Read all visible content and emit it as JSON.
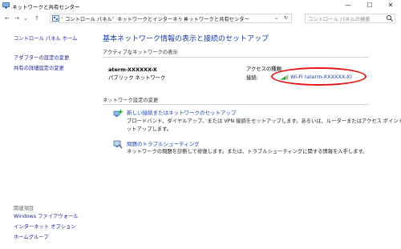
{
  "window": {
    "title": "ネットワークと共有センター"
  },
  "nav": {
    "breadcrumbs": [
      "コントロール パネル",
      "ネットワークとインターネット",
      "ネットワークと共有センター"
    ],
    "search_placeholder": "コントロール パネルの検索"
  },
  "sidebar": {
    "home": "コントロール パネル ホーム",
    "links": [
      "アダプターの設定の変更",
      "共有の詳細設定の変更"
    ],
    "related_header": "関連項目",
    "related_links": [
      "Windows ファイアウォール",
      "インターネット オプション",
      "ホームグループ"
    ]
  },
  "main": {
    "title": "基本ネットワーク情報の表示と接続のセットアップ",
    "active_networks_header": "アクティブなネットワークの表示",
    "network_name": "aterm-XXXXXX-X",
    "network_type": "パブリック ネットワーク",
    "access_type_label": "アクセスの種類:",
    "connection_label": "接続:",
    "connection_value": "Wi-Fi (aterm-XXXXXX-X)",
    "settings_header": "ネットワーク設定の変更",
    "tasks": [
      {
        "title": "新しい接続またはネットワークのセットアップ",
        "desc_lines": [
          "ブロードバンド、ダイヤルアップ、または VPN 接続をセットアップします。あるいは、ルーターまたはアクセス ポイントをセ",
          "ットアップします。"
        ]
      },
      {
        "title": "問題のトラブルシューティング",
        "desc_lines": [
          "ネットワークの問題を診断して修復します。または、トラブルシューティングに関する情報を入手します。"
        ]
      }
    ]
  },
  "colors": {
    "link": "#1b3fb0",
    "title": "#1a3da8",
    "annotation": "#e61414"
  }
}
